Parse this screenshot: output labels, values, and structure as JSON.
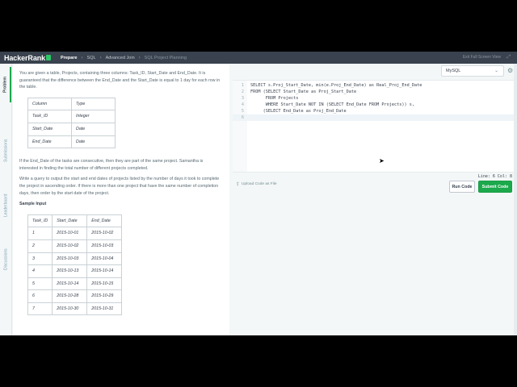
{
  "brand": {
    "name": "HackerRank"
  },
  "breadcrumbs": [
    {
      "label": "Prepare"
    },
    {
      "label": "SQL"
    },
    {
      "label": "Advanced Join"
    },
    {
      "label": "SQL Project Planning"
    }
  ],
  "header": {
    "exit_fullscreen": "Exit Full Screen View"
  },
  "side_tabs": [
    "Problem",
    "Submissions",
    "Leaderboard",
    "Discussions"
  ],
  "problem": {
    "intro": "You are given a table, Projects, containing three columns: Task_ID, Start_Date and End_Date. It is guaranteed that the difference between the End_Date and the Start_Date is equal to 1 day for each row in the table.",
    "schema": {
      "headers": [
        "Column",
        "Type"
      ],
      "rows": [
        [
          "Task_ID",
          "Integer"
        ],
        [
          "Start_Date",
          "Date"
        ],
        [
          "End_Date",
          "Date"
        ]
      ]
    },
    "para2": "If the End_Date of the tasks are consecutive, then they are part of the same project. Samantha is interested in finding the total number of different projects completed.",
    "para3": "Write a query to output the start and end dates of projects listed by the number of days it took to complete the project in ascending order. If there is more than one project that have the same number of completion days, then order by the start date of the project.",
    "sample_heading": "Sample Input",
    "sample": {
      "headers": [
        "Task_ID",
        "Start_Date",
        "End_Date"
      ],
      "rows": [
        [
          "1",
          "2015-10-01",
          "2015-10-02"
        ],
        [
          "2",
          "2015-10-02",
          "2015-10-03"
        ],
        [
          "3",
          "2015-10-03",
          "2015-10-04"
        ],
        [
          "4",
          "2015-10-13",
          "2015-10-14"
        ],
        [
          "5",
          "2015-10-14",
          "2015-10-15"
        ],
        [
          "6",
          "2015-10-28",
          "2015-10-29"
        ],
        [
          "7",
          "2015-10-30",
          "2015-10-31"
        ]
      ]
    }
  },
  "editor": {
    "language": "MySQL",
    "lines": [
      "SELECT s.Proj_Start_Date, min(e.Proj_End_Date) as Real_Proj_End_Date",
      "FROM (SELECT Start_Date as Proj_Start_Date",
      "      FROM Projects",
      "      WHERE Start_Date NOT IN (SELECT End_Date FROM Projects)) s,",
      "     (SELECT End_Date as Proj_End_Date",
      ""
    ],
    "line_numbers": [
      "1",
      "2",
      "3",
      "4",
      "5",
      "6"
    ],
    "status": "Line: 6 Col: 8"
  },
  "actions": {
    "upload": "Upload Code as File",
    "run": "Run Code",
    "submit": "Submit Code"
  },
  "colors": {
    "accent": "#1ba94c",
    "nav_bg": "#39424e"
  },
  "icons": [
    "expand-icon",
    "chevron-down-icon",
    "gear-icon",
    "upload-icon"
  ]
}
